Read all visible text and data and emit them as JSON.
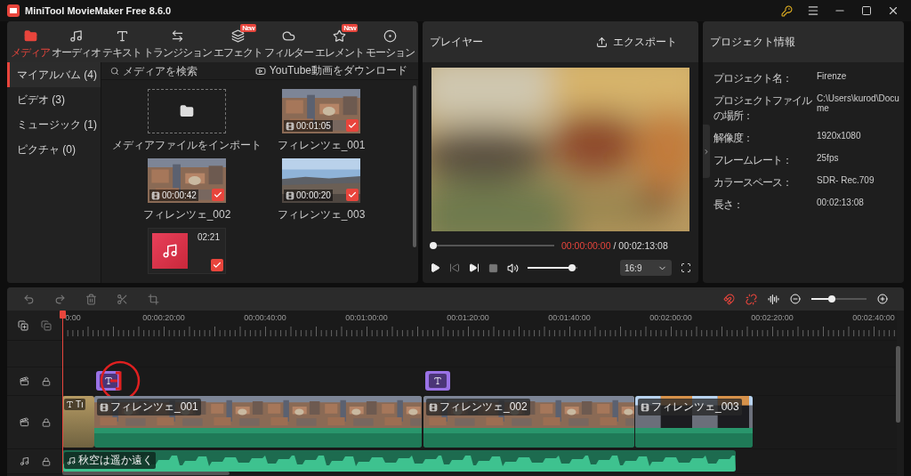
{
  "window": {
    "title": "MiniTool MovieMaker Free 8.6.0"
  },
  "tabs": [
    {
      "label": "メディア",
      "selected": true
    },
    {
      "label": "オーディオ",
      "selected": false
    },
    {
      "label": "テキスト",
      "selected": false
    },
    {
      "label": "トランジション",
      "selected": false
    },
    {
      "label": "エフェクト",
      "selected": false,
      "badge": "New"
    },
    {
      "label": "フィルター",
      "selected": false
    },
    {
      "label": "エレメント",
      "selected": false,
      "badge": "New"
    },
    {
      "label": "モーション",
      "selected": false
    }
  ],
  "sidebar": {
    "items": [
      {
        "label": "マイアルバム (4)",
        "selected": true
      },
      {
        "label": "ビデオ (3)",
        "selected": false
      },
      {
        "label": "ミュージック (1)",
        "selected": false
      },
      {
        "label": "ピクチャ (0)",
        "selected": false
      }
    ]
  },
  "media": {
    "search": {
      "placeholder": "メディアを検索"
    },
    "download": "YouTube動画をダウンロード",
    "items": [
      {
        "kind": "import",
        "label": "メディアファイルをインポート"
      },
      {
        "kind": "video",
        "label": "フィレンツェ_001",
        "duration": "00:01:05",
        "checked": true
      },
      {
        "kind": "video",
        "label": "フィレンツェ_002",
        "duration": "00:00:42",
        "checked": true
      },
      {
        "kind": "video",
        "label": "フィレンツェ_003",
        "duration": "00:00:20",
        "checked": true
      },
      {
        "kind": "audio",
        "duration": "02:21",
        "checked": true
      }
    ]
  },
  "player": {
    "title": "プレイヤー",
    "export": "エクスポート",
    "seek": {
      "level": 0
    },
    "current": "00:00:00:00",
    "total": "/ 00:02:13:08",
    "volume": {
      "level": 0.95
    },
    "aspect": "16:9"
  },
  "project_info": {
    "title": "プロジェクト情報",
    "rows": [
      {
        "label": "プロジェクト名：",
        "value": "Firenze"
      },
      {
        "label": "プロジェクトファイルの場所：",
        "value": "C:\\Users\\kurod\\Docume"
      },
      {
        "label": "解像度：",
        "value": "1920x1080"
      },
      {
        "label": "フレームレート：",
        "value": "25fps"
      },
      {
        "label": "カラースペース：",
        "value": "SDR- Rec.709"
      },
      {
        "label": "長さ：",
        "value": "00:02:13:08"
      }
    ]
  },
  "timeline": {
    "zoom": {
      "level": 0.35
    },
    "ruler": [
      "0:00",
      "00:00:20:00",
      "00:00:40:00",
      "00:01:00:00",
      "00:01:20:00",
      "00:01:40:00",
      "00:02:00:00",
      "00:02:20:00",
      "00:02:40:00"
    ],
    "text_clips": [
      {
        "kind": "text"
      },
      {
        "kind": "text"
      }
    ],
    "title_clip": {
      "label": "Tı"
    },
    "video_clips": [
      {
        "label": "フィレンツェ_001"
      },
      {
        "label": "フィレンツェ_002"
      },
      {
        "label": "フィレンツェ_003"
      }
    ],
    "audio_clip": {
      "label": "秋空は遥か遠く"
    }
  }
}
